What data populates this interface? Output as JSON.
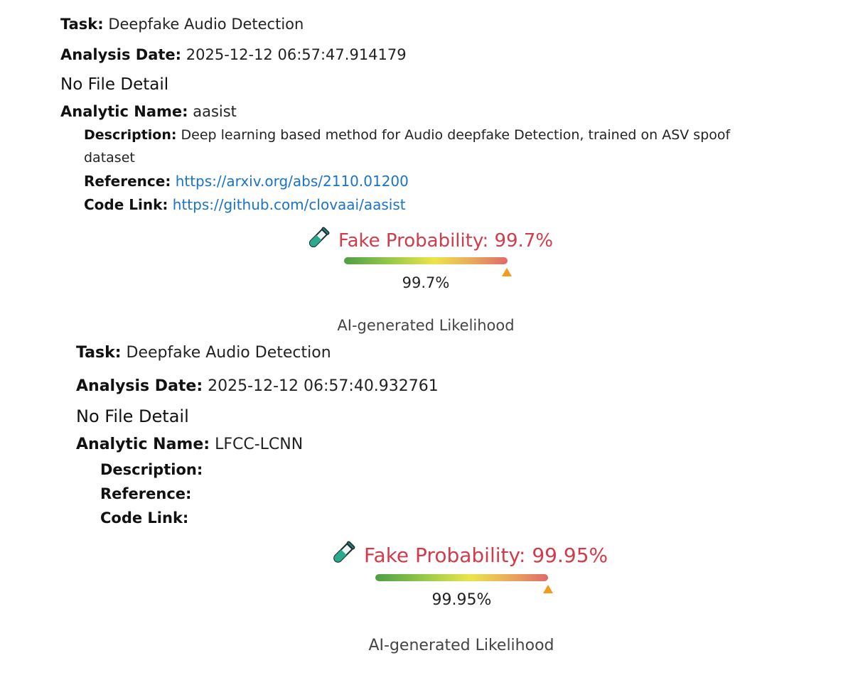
{
  "labels": {
    "task": "Task:",
    "analysis_date": "Analysis Date:",
    "analytic_name": "Analytic Name:",
    "description": "Description:",
    "reference": "Reference:",
    "code_link": "Code Link:",
    "fake_probability_prefix": "Fake Probability: ",
    "caption": "AI-generated Likelihood"
  },
  "results": [
    {
      "task": "Deepfake Audio Detection",
      "analysis_date": "2025-12-12 06:57:47.914179",
      "file_detail": "No File Detail",
      "analytic_name": "aasist",
      "description": "Deep learning based method for Audio deepfake Detection, trained on ASV spoof dataset",
      "reference": "https://arxiv.org/abs/2110.01200",
      "code_link": "https://github.com/clovaai/aasist",
      "fake_probability_title": "Fake Probability: 99.7%",
      "probability_text": "99.7%",
      "probability_value": 0.997
    },
    {
      "task": "Deepfake Audio Detection",
      "analysis_date": "2025-12-12 06:57:40.932761",
      "file_detail": "No File Detail",
      "analytic_name": "LFCC-LCNN",
      "description": "",
      "reference": "",
      "code_link": "",
      "fake_probability_title": "Fake Probability: 99.95%",
      "probability_text": "99.95%",
      "probability_value": 0.9995
    }
  ],
  "icons": {
    "probability_icon": "test-tube-icon"
  },
  "colors": {
    "probability_text": "#d23c4a",
    "link": "#1a73c8",
    "marker": "#f39b1c"
  }
}
